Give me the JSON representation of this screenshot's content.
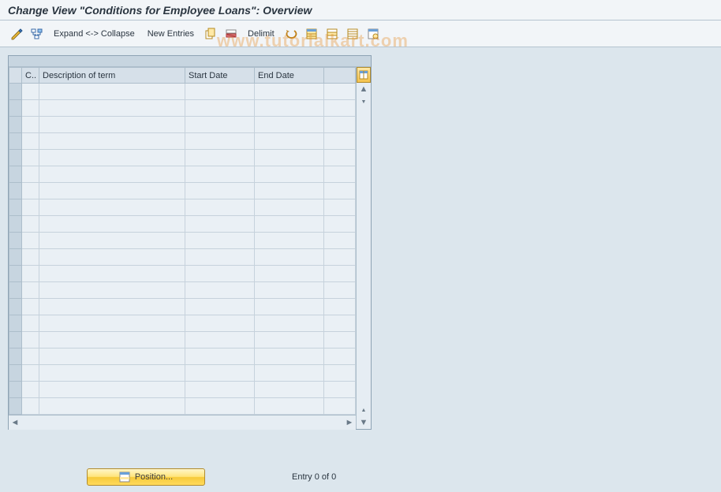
{
  "title": "Change View \"Conditions for Employee Loans\": Overview",
  "toolbar": {
    "expand_collapse": "Expand <-> Collapse",
    "new_entries": "New Entries",
    "delimit": "Delimit"
  },
  "table": {
    "columns": {
      "code": "C..",
      "description": "Description of term",
      "start": "Start Date",
      "end": "End Date"
    },
    "rows": [
      {
        "code": "",
        "description": "",
        "start": "",
        "end": ""
      },
      {
        "code": "",
        "description": "",
        "start": "",
        "end": ""
      },
      {
        "code": "",
        "description": "",
        "start": "",
        "end": ""
      },
      {
        "code": "",
        "description": "",
        "start": "",
        "end": ""
      },
      {
        "code": "",
        "description": "",
        "start": "",
        "end": ""
      },
      {
        "code": "",
        "description": "",
        "start": "",
        "end": ""
      },
      {
        "code": "",
        "description": "",
        "start": "",
        "end": ""
      },
      {
        "code": "",
        "description": "",
        "start": "",
        "end": ""
      },
      {
        "code": "",
        "description": "",
        "start": "",
        "end": ""
      },
      {
        "code": "",
        "description": "",
        "start": "",
        "end": ""
      },
      {
        "code": "",
        "description": "",
        "start": "",
        "end": ""
      },
      {
        "code": "",
        "description": "",
        "start": "",
        "end": ""
      },
      {
        "code": "",
        "description": "",
        "start": "",
        "end": ""
      },
      {
        "code": "",
        "description": "",
        "start": "",
        "end": ""
      },
      {
        "code": "",
        "description": "",
        "start": "",
        "end": ""
      },
      {
        "code": "",
        "description": "",
        "start": "",
        "end": ""
      },
      {
        "code": "",
        "description": "",
        "start": "",
        "end": ""
      },
      {
        "code": "",
        "description": "",
        "start": "",
        "end": ""
      },
      {
        "code": "",
        "description": "",
        "start": "",
        "end": ""
      },
      {
        "code": "",
        "description": "",
        "start": "",
        "end": ""
      }
    ]
  },
  "footer": {
    "position_button": "Position...",
    "entry_status": "Entry 0 of 0"
  },
  "watermark": "www.tutorialkart.com"
}
